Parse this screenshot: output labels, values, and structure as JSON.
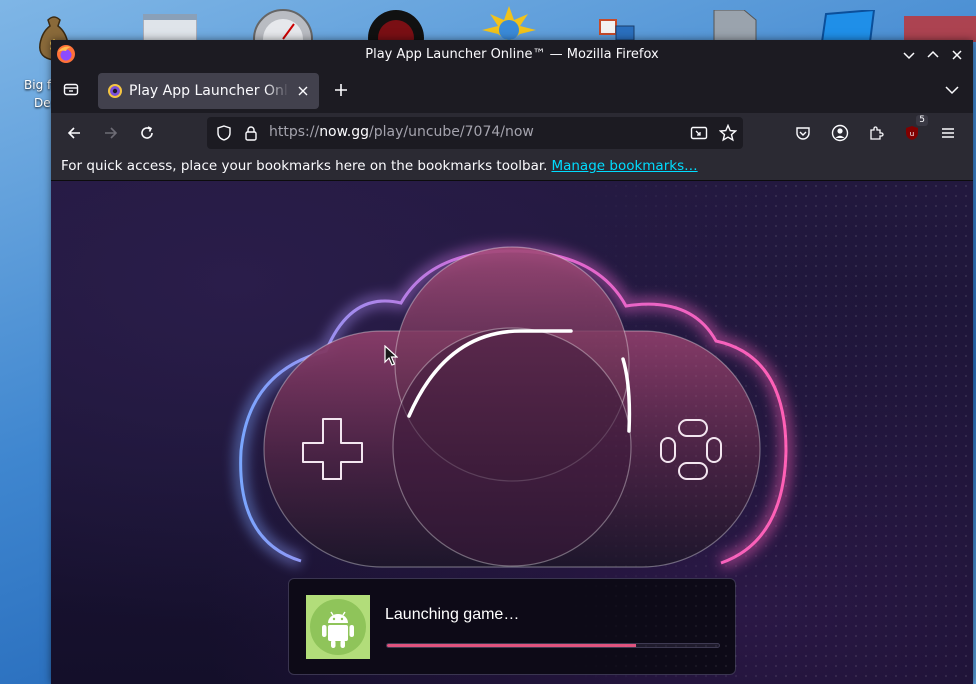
{
  "desktop": {
    "icons": [
      {
        "name": "money-bag-icon",
        "label": "Big f"
      },
      {
        "name": "media-player-icon"
      },
      {
        "name": "gauge-icon"
      },
      {
        "name": "red-disc-icon"
      },
      {
        "name": "sun-globe-icon"
      },
      {
        "name": "network-icon"
      },
      {
        "name": "drive-icon"
      },
      {
        "name": "window-icon"
      }
    ],
    "partial_labels": [
      "Big f",
      "De"
    ]
  },
  "window": {
    "title": "Play App Launcher Online™ — Mozilla Firefox",
    "tab": {
      "title": "Play App Launcher Online™ — Mozilla Firefox",
      "short_title": "Play App Launcher Online™"
    },
    "url": {
      "scheme": "https://",
      "host": "now.gg",
      "path": "/play/uncube/7074/now"
    },
    "bookmarks_bar": {
      "message": "For quick access, place your bookmarks here on the bookmarks toolbar.",
      "link": "Manage bookmarks…"
    },
    "extension_badge": "5"
  },
  "page": {
    "launch_text": "Launching game…",
    "progress": 0.75,
    "colors": {
      "accent_pink": "#e0537e",
      "thumb_green": "#b2dd7a",
      "glow_blue": "#7aa6ff",
      "glow_pink": "#ff5fb5"
    }
  }
}
